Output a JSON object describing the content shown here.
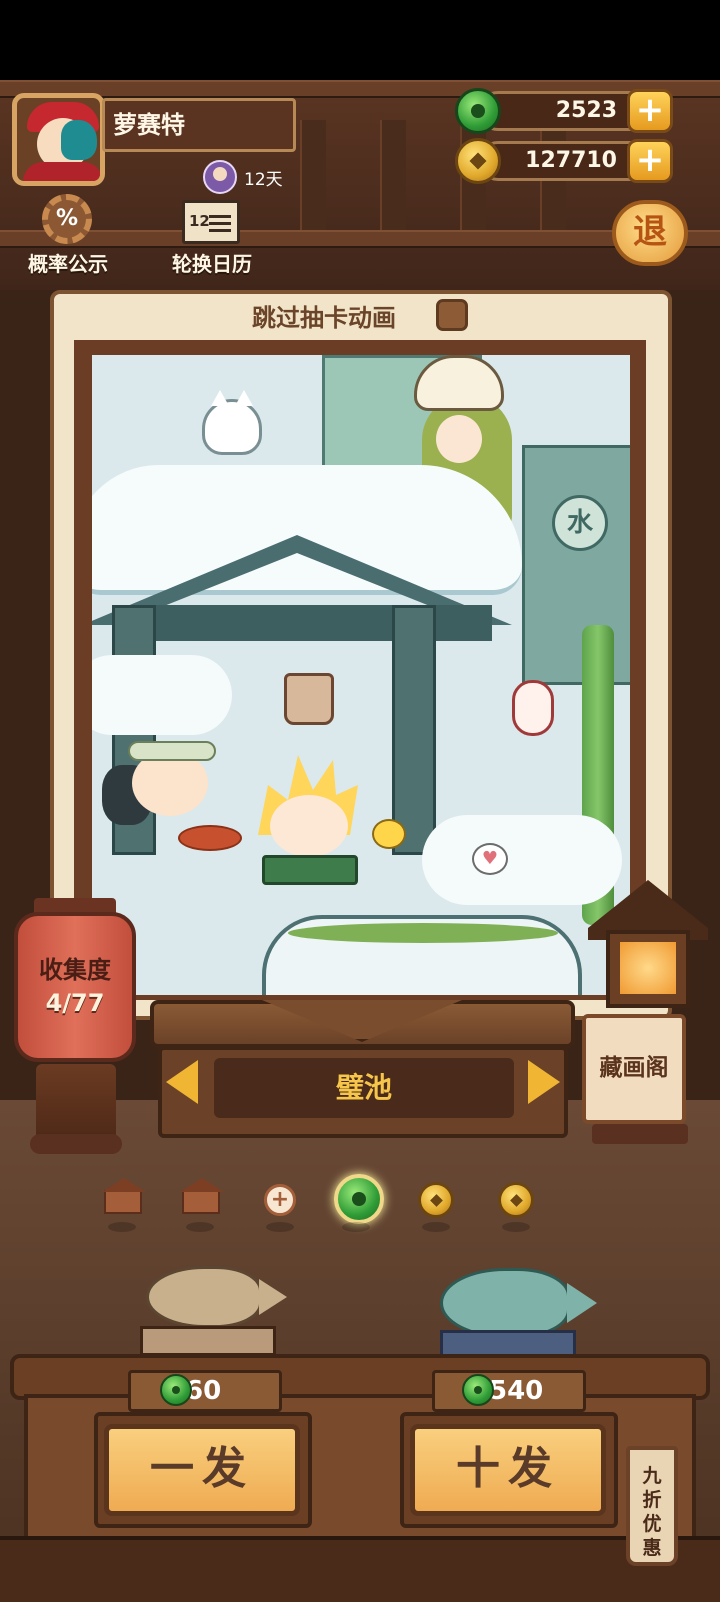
{
  "player": {
    "name": "萝赛特",
    "vip_days": "12天"
  },
  "currency": {
    "jade": "2523",
    "coins": "127710"
  },
  "top_buttons": {
    "rate_label": "概率公示",
    "rate_icon_text": "%",
    "calendar_label": "轮换日历",
    "calendar_icon_text": "12",
    "exit_label": "退"
  },
  "card": {
    "skip_animation_label": "跳过抽卡动画",
    "skip_checked": false,
    "water_sign": "水"
  },
  "collection": {
    "label": "收集度",
    "value": "4/77"
  },
  "banner": {
    "name": "璧池"
  },
  "gallery": {
    "label": "藏画阁"
  },
  "pagination": {
    "items": [
      "house-icon",
      "house-icon",
      "plus-icon",
      "jade-icon",
      "coin-icon",
      "coin-icon"
    ],
    "active_index": 3
  },
  "draws": {
    "single": {
      "label": "一发",
      "price": "60"
    },
    "ten": {
      "label": "十发",
      "price": "540"
    },
    "discount_label": "九折优惠"
  },
  "colors": {
    "accent_gold": "#f0b533",
    "jade_green": "#2f9c36",
    "wood_dark": "#3e2415"
  }
}
